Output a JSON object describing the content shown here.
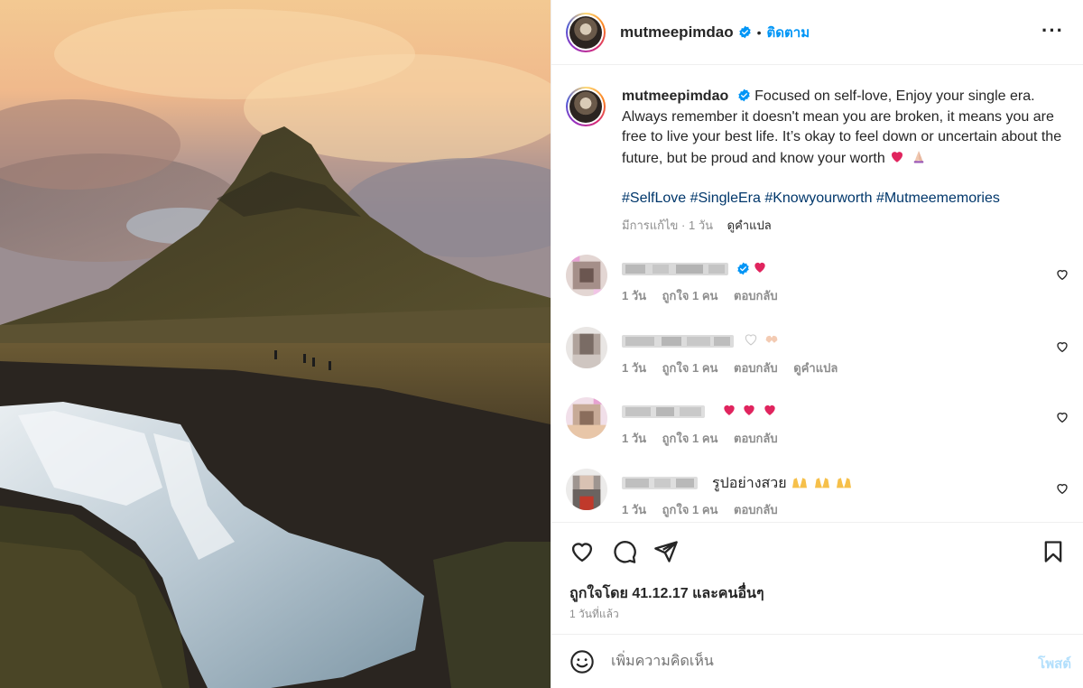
{
  "post": {
    "username": "mutmeepimdao",
    "follow_label": "ติดตาม",
    "more_icon": "more-horizontal-icon",
    "caption_text": "Focused on self-love, Enjoy your single era. Always remember it doesn't mean you are broken, it means you are free to live your best life. It’s okay to feel down or uncertain about the future, but be proud and know your worth",
    "caption_emojis": [
      "red-heart",
      "folded-hands"
    ],
    "hashtags": "#SelfLove #SingleEra #Knowyourworth #Mutmeememories",
    "edited_label": "มีการแก้ไข",
    "caption_age": "1 วัน",
    "translate_label": "ดูคำแปล"
  },
  "comments": [
    {
      "name": "[blurred username]",
      "verified": true,
      "text": "",
      "emojis": [
        "red-heart"
      ],
      "age": "1 วัน",
      "likes": "ถูกใจ 1 คน",
      "reply": "ตอบกลับ",
      "translate": ""
    },
    {
      "name": "[blurred username]",
      "verified": false,
      "text": "",
      "emojis": [
        "white-heart",
        "heart-hands"
      ],
      "age": "1 วัน",
      "likes": "ถูกใจ 1 คน",
      "reply": "ตอบกลับ",
      "translate": "ดูคำแปล"
    },
    {
      "name": "[blurred username]",
      "verified": false,
      "text": "",
      "emojis": [
        "red-heart",
        "red-heart",
        "red-heart"
      ],
      "age": "1 วัน",
      "likes": "ถูกใจ 1 คน",
      "reply": "ตอบกลับ",
      "translate": ""
    },
    {
      "name": "[blurred username]",
      "verified": false,
      "text": "รูปอย่างสวย",
      "emojis": [
        "raising-hands",
        "raising-hands",
        "raising-hands"
      ],
      "age": "1 วัน",
      "likes": "ถูกใจ 1 คน",
      "reply": "ตอบกลับ",
      "translate": ""
    }
  ],
  "actions": {
    "icons": [
      "heart-icon",
      "comment-icon",
      "share-icon",
      "bookmark-icon"
    ],
    "likes_text": "ถูกใจโดย 41.12.17 และคนอื่นๆ",
    "time_text": "1 วันที่แล้ว"
  },
  "comment_box": {
    "placeholder": "เพิ่มความคิดเห็น",
    "post_label": "โพสต์",
    "emoji_icon": "smiley-icon"
  },
  "colors": {
    "accent": "#0095f6",
    "hashtag": "#00376b",
    "muted": "#8e8e8e",
    "heart": "#ed4956",
    "post_disabled": "#b2dffc"
  }
}
